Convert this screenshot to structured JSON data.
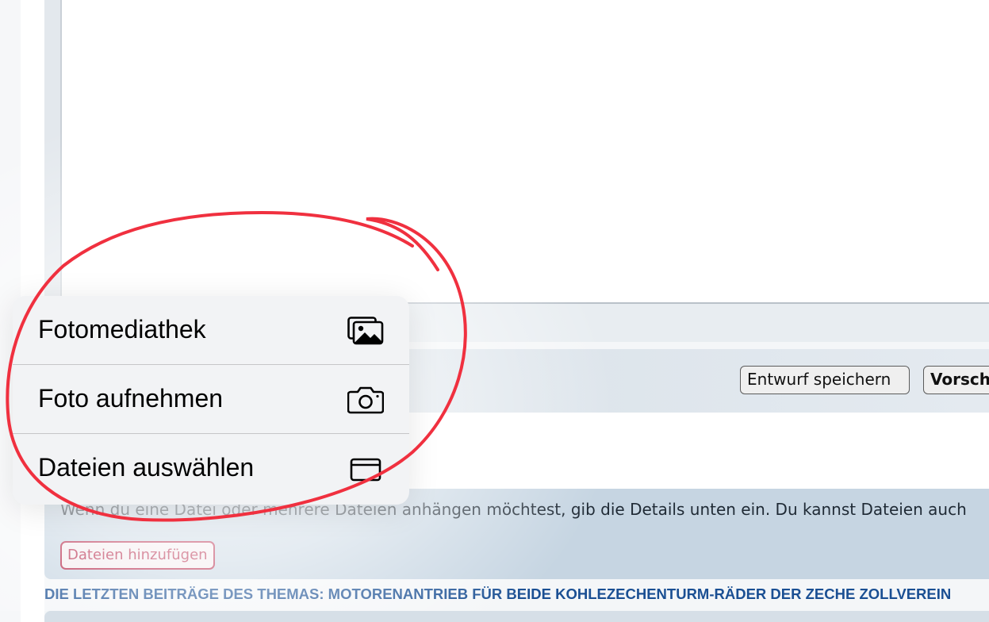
{
  "toolbar": {
    "save_label": "Entwurf speichern",
    "preview_label": "Vorschau"
  },
  "attachments": {
    "description": "Wenn du eine Datei oder mehrere Dateien anhängen möchtest, gib die Details unten ein. Du kannst Dateien auch",
    "add_files_label": "Dateien hinzufügen"
  },
  "thread": {
    "heading": "DIE LETZTEN BEITRÄGE DES THEMAS: MOTORENANTRIEB FÜR BEIDE KOHLEZECHENTURM-RÄDER DER ZECHE ZOLLVEREIN"
  },
  "popover": {
    "items": [
      {
        "label": "Fotomediathek",
        "icon": "photo-library-icon"
      },
      {
        "label": "Foto aufnehmen",
        "icon": "camera-icon"
      },
      {
        "label": "Dateien auswählen",
        "icon": "folder-icon"
      }
    ]
  },
  "colors": {
    "annotation": "#f0303f",
    "link_heading": "#1a4f93",
    "add_button": "#b0163a"
  }
}
